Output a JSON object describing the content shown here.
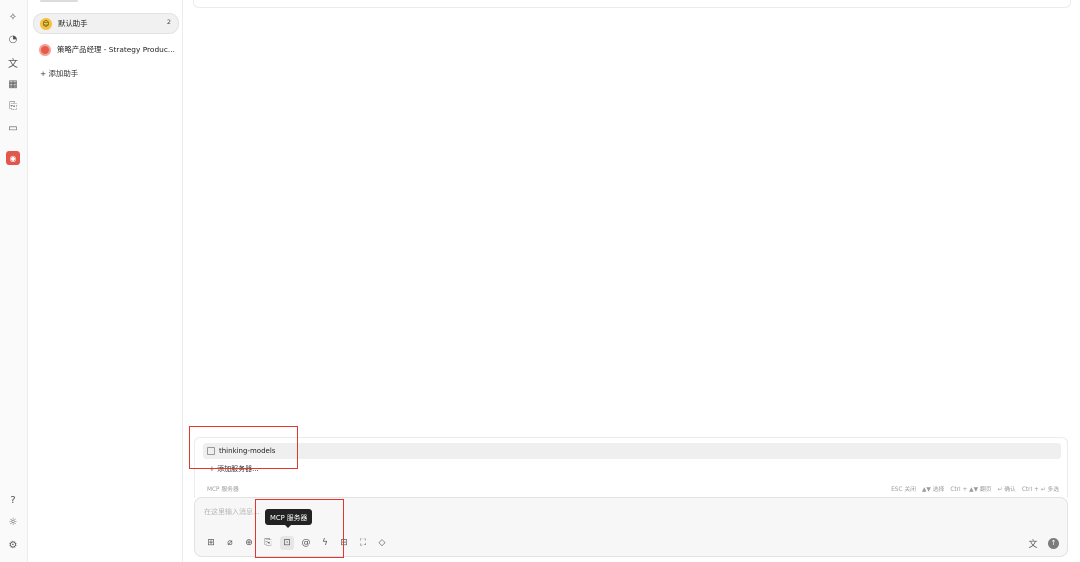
{
  "sidebar": {
    "assistants": [
      {
        "name": "默认助手",
        "count": "2",
        "active": true
      },
      {
        "name": "策略产品经理 - Strategy Produc...",
        "active": false
      }
    ],
    "add_assistant": "+ 添加助手"
  },
  "mcp": {
    "servers": [
      {
        "name": "thinking-models"
      }
    ],
    "add_server": "+ 添加服务器...",
    "panel_label": "MCP 服务器",
    "hints": [
      "ESC 关闭",
      "▲▼ 选择",
      "Ctrl + ▲▼ 翻页",
      "↵ 确认",
      "Ctrl + ↵ 多选"
    ]
  },
  "input": {
    "placeholder": "在这里输入消息...",
    "tooltip": "MCP 服务器"
  },
  "icons": {
    "rail": [
      "sparkle-icon",
      "palette-icon",
      "translate-icon",
      "apps-icon",
      "files-icon",
      "folder-icon",
      "app-icon",
      "help-icon",
      "theme-icon",
      "settings-icon"
    ],
    "toolbar": [
      "new-topic-icon",
      "attach-icon",
      "web-search-icon",
      "knowledge-icon",
      "mcp-icon",
      "mention-icon",
      "quick-phrase-icon",
      "clear-icon",
      "expand-icon",
      "eraser-icon"
    ]
  }
}
